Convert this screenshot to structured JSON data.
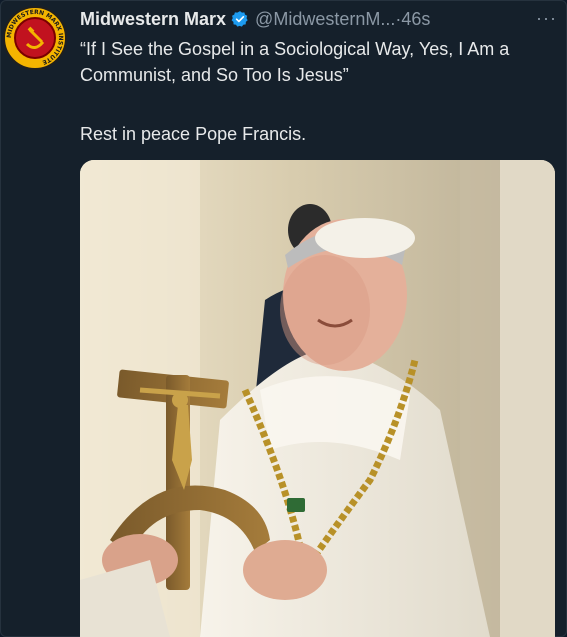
{
  "tweet": {
    "author_name": "Midwestern Marx",
    "handle": "@MidwesternM...",
    "separator": "·",
    "time": "46s",
    "more": "···",
    "quote": "“If I See the Gospel in a Sociological Way, Yes, I Am a Communist, and So Too Is Jesus”",
    "caption": "Rest in peace Pope Francis.",
    "avatar_text": "MIDWESTERN MARX INSTITUTE"
  },
  "colors": {
    "background": "#15202b",
    "text": "#e7e9ea",
    "muted": "#8b98a5",
    "verified": "#1d9bf0",
    "avatar_gold": "#f4b400",
    "avatar_red": "#c1121f"
  },
  "icons": {
    "verified": "verified-badge-icon",
    "more": "more-options-icon"
  }
}
